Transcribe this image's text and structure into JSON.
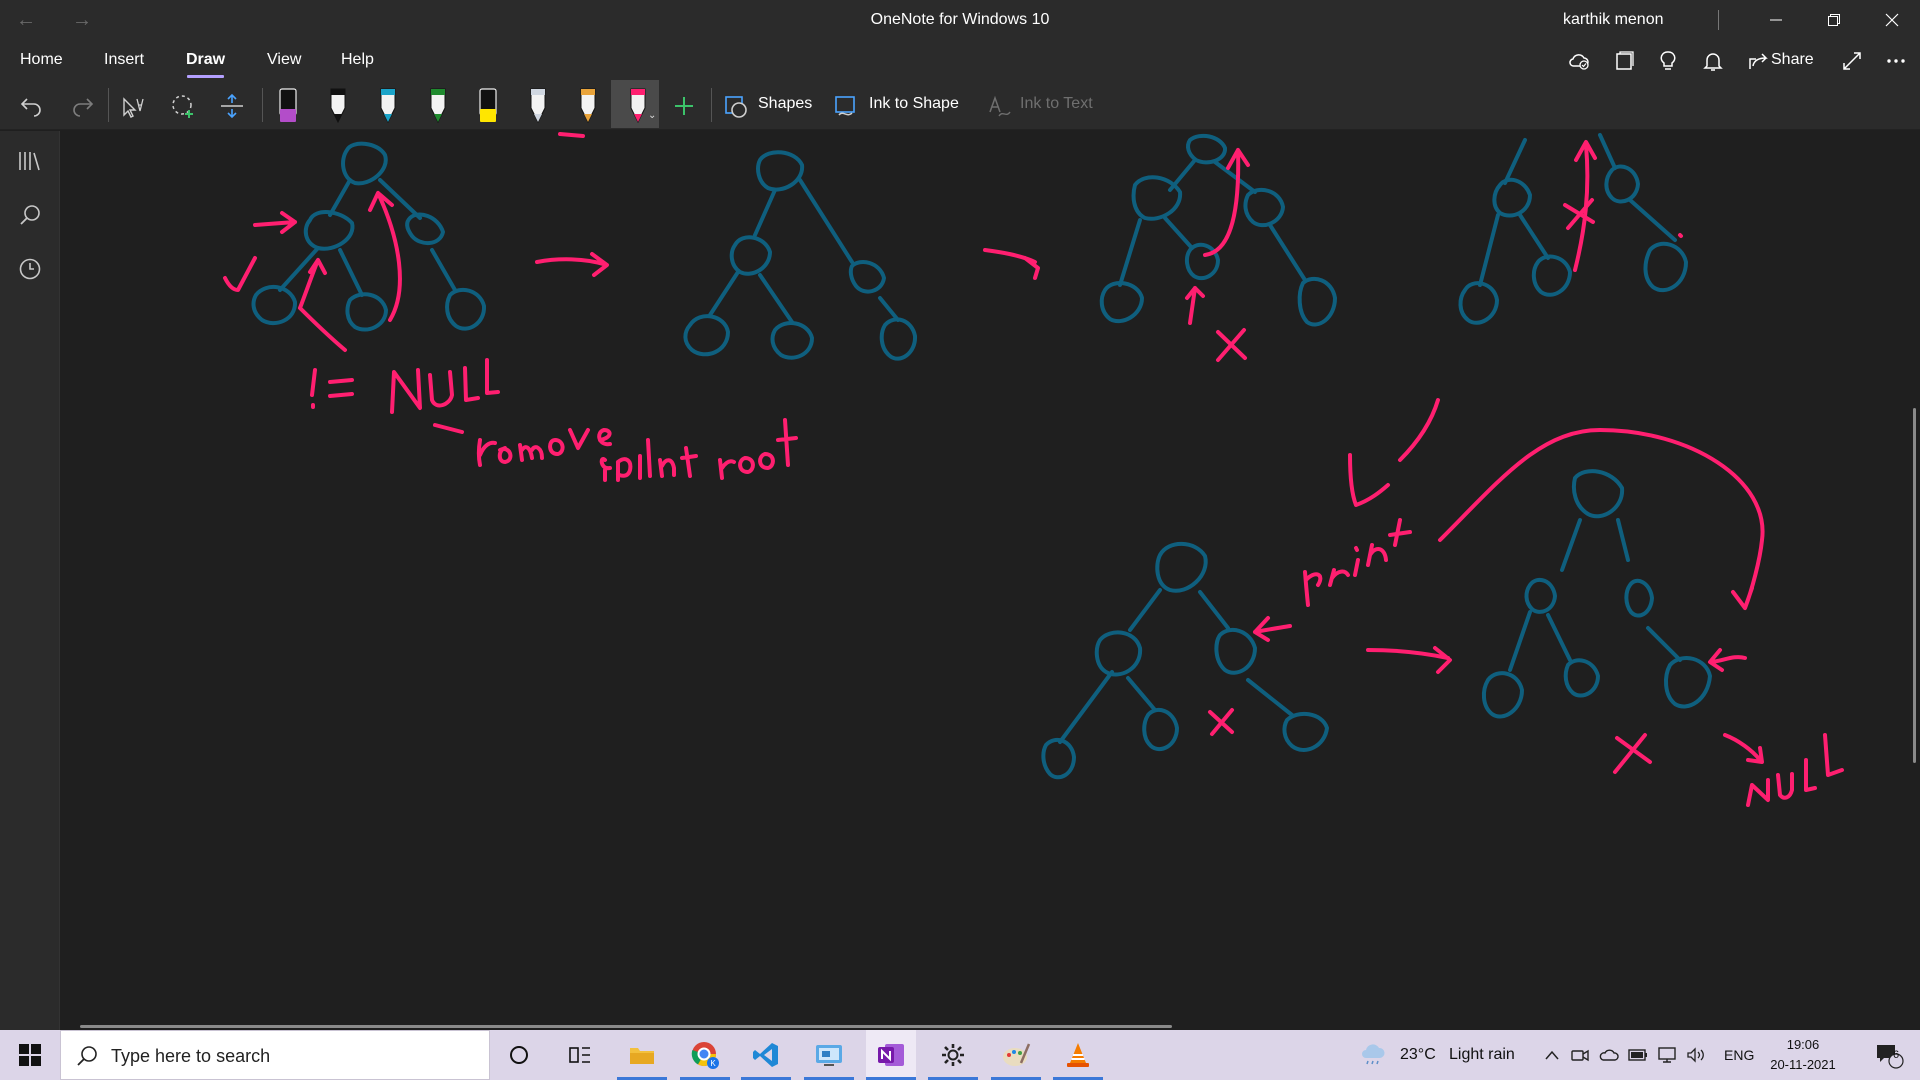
{
  "window": {
    "title": "OneNote for Windows 10",
    "user": "karthik menon"
  },
  "menu": {
    "tabs": [
      "Home",
      "Insert",
      "Draw",
      "View",
      "Help"
    ],
    "active": "Draw",
    "share_label": "Share"
  },
  "toolbar": {
    "shapes_label": "Shapes",
    "ink_to_shape_label": "Ink to Shape",
    "ink_to_text_label": "Ink to Text",
    "pens": [
      {
        "name": "highlighter-purple",
        "color": "#b34dc9"
      },
      {
        "name": "pen-black",
        "color": "#111111"
      },
      {
        "name": "pen-teal",
        "color": "#1aa3c8"
      },
      {
        "name": "pen-green",
        "color": "#1f8a2e"
      },
      {
        "name": "highlighter-yellow",
        "color": "#ffe600"
      },
      {
        "name": "pen-galaxy",
        "color": "#cfd6e0"
      },
      {
        "name": "pen-rainbow",
        "color": "#e8a33a"
      },
      {
        "name": "pen-pink-selected",
        "color": "#ff1f70"
      }
    ]
  },
  "canvas": {
    "ink_colors": {
      "tree": "#0f5f7e",
      "annotation": "#ff1f70"
    }
  },
  "taskbar": {
    "search_placeholder": "Type here to search",
    "weather_temp": "23°C",
    "weather_desc": "Light rain",
    "language": "ENG",
    "time": "19:06",
    "date": "20-11-2021",
    "notification_count": "6"
  }
}
